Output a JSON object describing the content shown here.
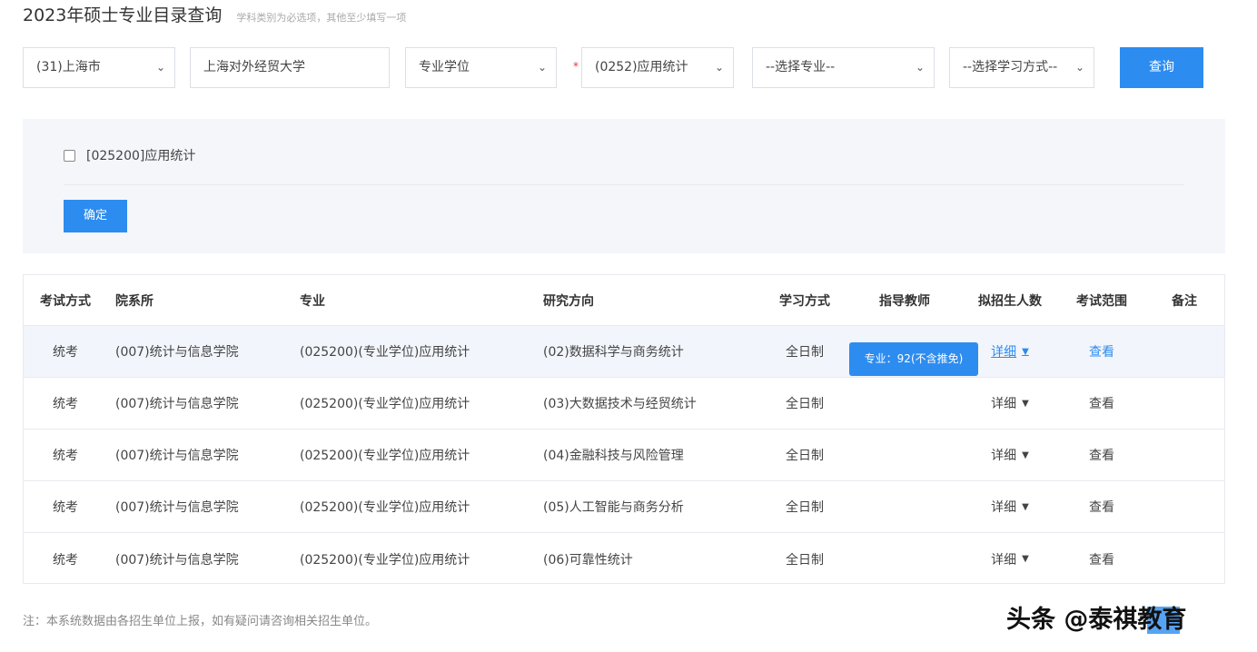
{
  "header": {
    "title": "2023年硕士专业目录查询",
    "hint": "学科类别为必选项，其他至少填写一项"
  },
  "filters": {
    "province": "(31)上海市",
    "school": "上海对外经贸大学",
    "degree_type": "专业学位",
    "required_mark": "*",
    "discipline": "(0252)应用统计",
    "major_placeholder": "--选择专业--",
    "study_mode_placeholder": "--选择学习方式--",
    "query_label": "查询"
  },
  "major_panel": {
    "option": "[025200]应用统计",
    "confirm_label": "确定"
  },
  "table": {
    "headers": [
      "考试方式",
      "院系所",
      "专业",
      "研究方向",
      "学习方式",
      "指导教师",
      "拟招生人数",
      "考试范围",
      "备注"
    ],
    "rows": [
      {
        "exam": "统考",
        "dept": "(007)统计与信息学院",
        "major": "(025200)(专业学位)应用统计",
        "direction": "(02)数据科学与商务统计",
        "mode": "全日制",
        "tutor": "",
        "quota": "详细",
        "scope": "查看",
        "note": ""
      },
      {
        "exam": "统考",
        "dept": "(007)统计与信息学院",
        "major": "(025200)(专业学位)应用统计",
        "direction": "(03)大数据技术与经贸统计",
        "mode": "全日制",
        "tutor": "",
        "quota": "详细",
        "scope": "查看",
        "note": ""
      },
      {
        "exam": "统考",
        "dept": "(007)统计与信息学院",
        "major": "(025200)(专业学位)应用统计",
        "direction": "(04)金融科技与风险管理",
        "mode": "全日制",
        "tutor": "",
        "quota": "详细",
        "scope": "查看",
        "note": ""
      },
      {
        "exam": "统考",
        "dept": "(007)统计与信息学院",
        "major": "(025200)(专业学位)应用统计",
        "direction": "(05)人工智能与商务分析",
        "mode": "全日制",
        "tutor": "",
        "quota": "详细",
        "scope": "查看",
        "note": ""
      },
      {
        "exam": "统考",
        "dept": "(007)统计与信息学院",
        "major": "(025200)(专业学位)应用统计",
        "direction": "(06)可靠性统计",
        "mode": "全日制",
        "tutor": "",
        "quota": "详细",
        "scope": "查看",
        "note": ""
      }
    ],
    "tooltip": "专业：92(不含推免)"
  },
  "footer": {
    "note": "注：本系统数据由各招生单位上报，如有疑问请咨询相关招生单位。"
  },
  "watermark": "头条 @泰祺教育",
  "icons": {
    "dropdown": "chevron-down-icon",
    "expand": "triangle-down-icon"
  },
  "colors": {
    "primary": "#2d8cf0",
    "panel_bg": "#f4f6fa",
    "highlight_row": "#f2f5fb"
  }
}
